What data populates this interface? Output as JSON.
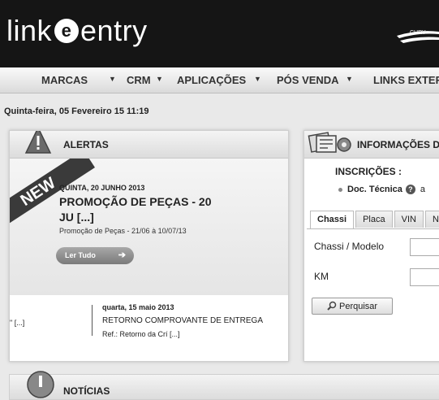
{
  "header": {
    "logo_left": "link",
    "logo_e": "e",
    "logo_right": "entry",
    "brand_text": "CHRY"
  },
  "nav": {
    "items": [
      {
        "label": "MARCAS"
      },
      {
        "label": "CRM"
      },
      {
        "label": "APLICAÇÕES"
      },
      {
        "label": "PÓS VENDA"
      },
      {
        "label": "LINKS EXTERI"
      }
    ],
    "arrow": "▼"
  },
  "date": "Quinta-feira, 05 Fevereiro 15 11:19",
  "alerts": {
    "title": "ALERTAS",
    "badge": "NEW",
    "featured": {
      "date": "QUINTA, 20 JUNHO 2013",
      "title": "PROMOÇÃO DE PEÇAS - 20 JU  [...]",
      "desc": "Promoção de Peças - 21/06 à 10/07/13",
      "button": "Ler Tudo",
      "button_arrow": "➔"
    },
    "prev_text": "\" [...]",
    "second": {
      "date": "quarta, 15 maio 2013",
      "title": "RETORNO COMPROVANTE DE ENTREGA",
      "ref": "Ref.: Retorno da Crí [...]"
    }
  },
  "info": {
    "title": "INFORMAÇÕES DO",
    "inscricoes_label": "INSCRIÇÕES :",
    "doc_label": "Doc. Técnica",
    "help_glyph": "?",
    "doc_suffix": "a",
    "tabs": [
      {
        "label": "Chassi"
      },
      {
        "label": "Placa"
      },
      {
        "label": "VIN"
      },
      {
        "label": "N"
      }
    ],
    "chassi_label": "Chassi / Modelo",
    "km_label": "KM",
    "search_button": "Perquisar"
  },
  "news": {
    "title": "NOTÍCIAS"
  },
  "colors": {
    "header_bg": "#151515",
    "page_bg": "#e9e9e9",
    "ribbon": "#3a3a3a"
  }
}
